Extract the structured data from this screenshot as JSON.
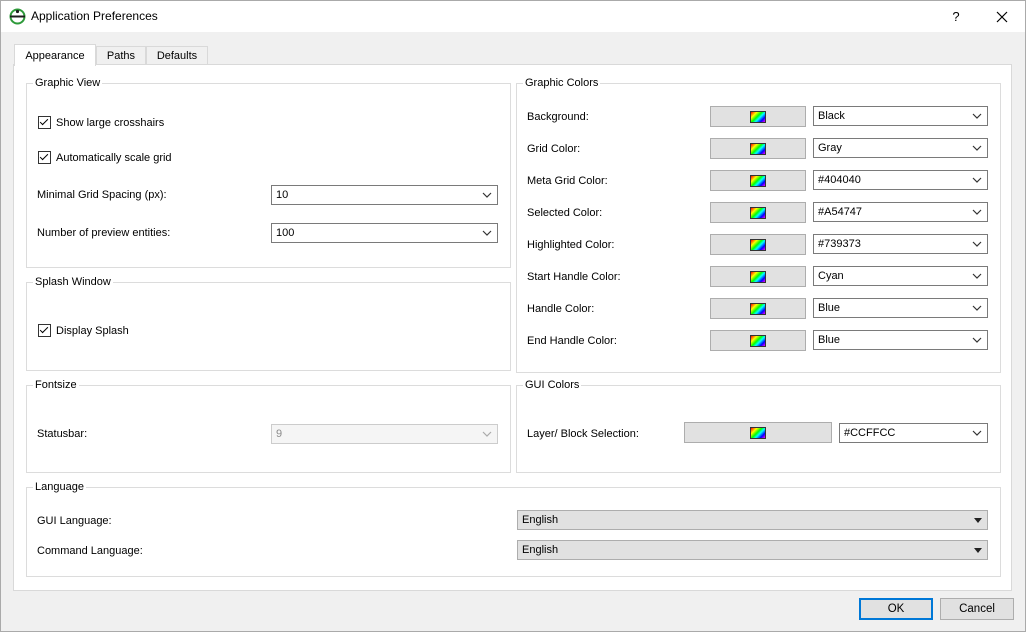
{
  "window": {
    "title": "Application Preferences",
    "help_label": "?",
    "close_label": "✕"
  },
  "tabs": [
    {
      "label": "Appearance",
      "active": true
    },
    {
      "label": "Paths",
      "active": false
    },
    {
      "label": "Defaults",
      "active": false
    }
  ],
  "graphic_view": {
    "title": "Graphic View",
    "show_crosshairs": {
      "label": "Show large crosshairs",
      "checked": true
    },
    "auto_scale_grid": {
      "label": "Automatically scale grid",
      "checked": true
    },
    "min_grid_spacing": {
      "label": "Minimal Grid Spacing (px):",
      "value": "10"
    },
    "preview_entities": {
      "label": "Number of preview entities:",
      "value": "100"
    }
  },
  "splash_window": {
    "title": "Splash Window",
    "display_splash": {
      "label": "Display Splash",
      "checked": true
    }
  },
  "fontsize": {
    "title": "Fontsize",
    "statusbar": {
      "label": "Statusbar:",
      "value": "9"
    }
  },
  "language": {
    "title": "Language",
    "gui_language": {
      "label": "GUI Language:",
      "value": "English"
    },
    "command_language": {
      "label": "Command Language:",
      "value": "English"
    }
  },
  "graphic_colors": {
    "title": "Graphic Colors",
    "rows": [
      {
        "label": "Background:",
        "value": "Black"
      },
      {
        "label": "Grid Color:",
        "value": "Gray"
      },
      {
        "label": "Meta Grid Color:",
        "value": "#404040"
      },
      {
        "label": "Selected Color:",
        "value": "#A54747"
      },
      {
        "label": "Highlighted Color:",
        "value": "#739373"
      },
      {
        "label": "Start Handle Color:",
        "value": "Cyan"
      },
      {
        "label": "Handle Color:",
        "value": "Blue"
      },
      {
        "label": "End Handle Color:",
        "value": "Blue"
      }
    ]
  },
  "gui_colors": {
    "title": "GUI Colors",
    "layer_block_selection": {
      "label": "Layer/ Block Selection:",
      "value": "#CCFFCC"
    }
  },
  "buttons": {
    "ok": "OK",
    "cancel": "Cancel"
  },
  "icons": {
    "app": "app-logo-icon",
    "chevron": "chevron-down-icon",
    "swatch": "color-palette-icon"
  },
  "colors": {
    "accent": "#0078d7",
    "panel": "#ffffff",
    "chrome": "#f0f0f0"
  }
}
